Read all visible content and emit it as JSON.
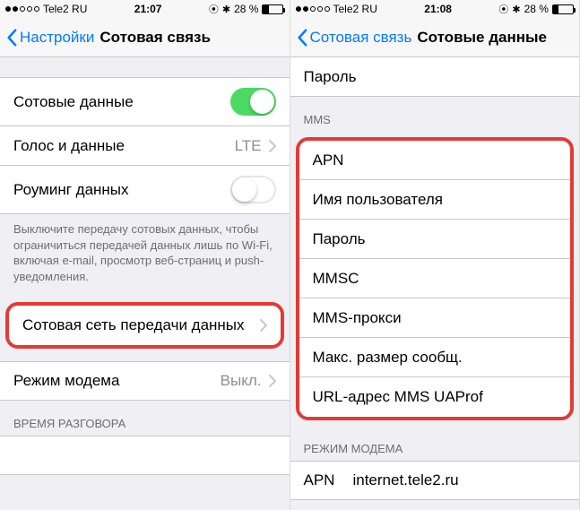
{
  "left": {
    "status": {
      "carrier": "Tele2 RU",
      "time": "21:07",
      "battery": "28 %"
    },
    "nav": {
      "back": "Настройки",
      "title": "Сотовая связь"
    },
    "rows": {
      "cellular_data": "Сотовые данные",
      "voice_data": "Голос и данные",
      "voice_data_value": "LTE",
      "data_roaming": "Роуминг данных"
    },
    "footer": "Выключите передачу сотовых данных, чтобы ограничиться передачей данных лишь по Wi-Fi, включая e-mail, просмотр веб-страниц и push-уведомления.",
    "cellular_network": "Сотовая сеть передачи данных",
    "hotspot": "Режим модема",
    "hotspot_value": "Выкл.",
    "talk_time_header": "ВРЕМЯ РАЗГОВОРА"
  },
  "right": {
    "status": {
      "carrier": "Tele2 RU",
      "time": "21:08",
      "battery": "28 %"
    },
    "nav": {
      "back": "Сотовая связь",
      "title": "Сотовые данные"
    },
    "password": "Пароль",
    "mms_header": "MMS",
    "mms_fields": [
      "APN",
      "Имя пользователя",
      "Пароль",
      "MMSC",
      "MMS-прокси",
      "Макс. размер сообщ.",
      "URL-адрес MMS UAProf"
    ],
    "modem_header": "РЕЖИМ МОДЕМА",
    "apn_label": "APN",
    "apn_value": "internet.tele2.ru"
  }
}
